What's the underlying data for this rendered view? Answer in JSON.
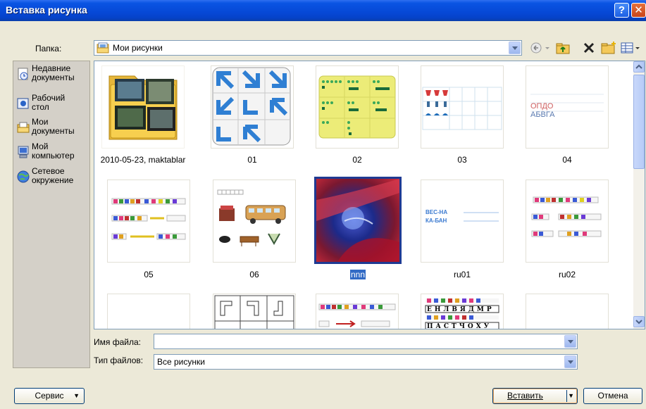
{
  "window": {
    "title": "Вставка рисунка",
    "help_label": "?",
    "close_label": "✕"
  },
  "folder": {
    "label": "Папка:",
    "value": "Мои рисунки",
    "icon": "my-pictures-folder-icon"
  },
  "toolbar": {
    "tools": [
      "back-icon",
      "up-folder-icon",
      "delete-icon",
      "new-folder-icon",
      "views-icon"
    ]
  },
  "places": [
    {
      "label": "Недавние\nдокументы",
      "icon": "recent-documents-icon"
    },
    {
      "label": "Рабочий\nстол",
      "icon": "desktop-icon"
    },
    {
      "label": "Мои\nдокументы",
      "icon": "my-documents-icon"
    },
    {
      "label": "Мой\nкомпьютер",
      "icon": "my-computer-icon"
    },
    {
      "label": "Сетевое\nокружение",
      "icon": "network-icon"
    }
  ],
  "files": [
    {
      "name": "2010-05-23, maktablar",
      "selected": false
    },
    {
      "name": "01",
      "selected": false
    },
    {
      "name": "02",
      "selected": false
    },
    {
      "name": "03",
      "selected": false
    },
    {
      "name": "04",
      "selected": false
    },
    {
      "name": "05",
      "selected": false
    },
    {
      "name": "06",
      "selected": false
    },
    {
      "name": "nnn",
      "selected": true
    },
    {
      "name": "ru01",
      "selected": false
    },
    {
      "name": "ru02",
      "selected": false
    }
  ],
  "thumb_text": {
    "t04_line1": "ОПДО",
    "t04_line2": "АБВГА",
    "ru01_line1": "ВЕС-НА",
    "ru01_line2": "КА-БАН",
    "r3_letters_1": "ЕНЛВЯДМР",
    "r3_letters_2": "ПАСТЧОХУ"
  },
  "filename": {
    "label": "Имя файла:",
    "value": ""
  },
  "filetype": {
    "label": "Тип файлов:",
    "value": "Все рисунки"
  },
  "buttons": {
    "service": "Сервис",
    "insert": "Вставить",
    "cancel": "Отмена"
  },
  "colors": {
    "title_bar": "#0648d6",
    "selection": "#316ac5",
    "thumb_border_selected": "#1f3a93"
  }
}
